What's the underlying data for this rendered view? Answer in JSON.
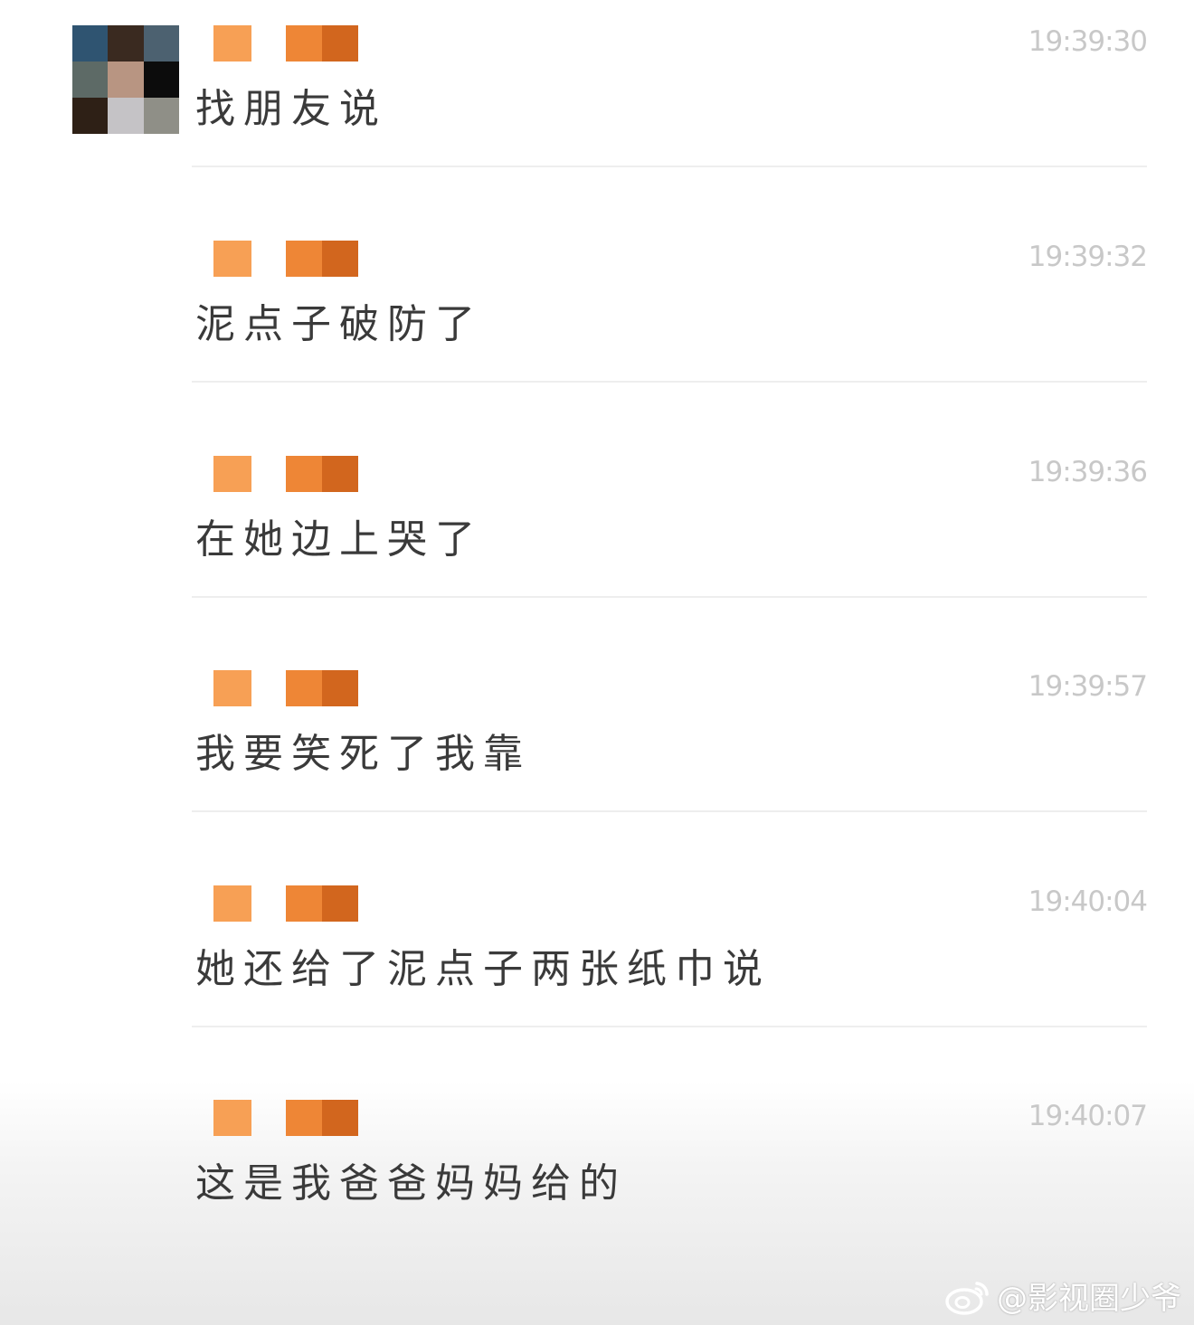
{
  "chat": {
    "avatar_colors": [
      "#2f5471",
      "#3a2a20",
      "#4c6170",
      "#5d6a66",
      "#b89582",
      "#0c0c0c",
      "#2e2016",
      "#c5c3c6",
      "#8f8f87"
    ],
    "name_block_colors": [
      "#f7a055",
      "#ee8636",
      "#d2661e"
    ],
    "messages": [
      {
        "time": "19:39:30",
        "text": "找朋友说"
      },
      {
        "time": "19:39:32",
        "text": "泥点子破防了"
      },
      {
        "time": "19:39:36",
        "text": "在她边上哭了"
      },
      {
        "time": "19:39:57",
        "text": "我要笑死了我靠"
      },
      {
        "time": "19:40:04",
        "text": "她还给了泥点子两张纸巾说"
      },
      {
        "time": "19:40:07",
        "text": "这是我爸爸妈妈给的"
      }
    ]
  },
  "watermark": {
    "icon": "weibo-icon",
    "text": "@影视圈少爷"
  }
}
